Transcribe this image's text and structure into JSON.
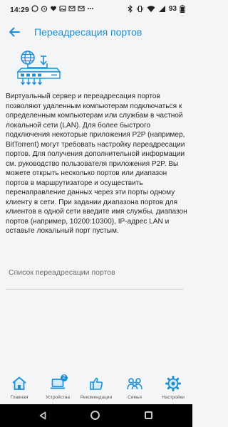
{
  "status_bar": {
    "time": "14:29",
    "battery": "93",
    "left_icons": [
      "whatsapp-icon",
      "alarm-icon",
      "heart-icon",
      "picture-icon",
      "email-icon",
      "email-icon",
      "more-dots-icon"
    ],
    "right_icons": [
      "bluetooth-icon",
      "vibrate-icon",
      "wifi-icon",
      "signal-icon",
      "battery-icon"
    ]
  },
  "header": {
    "title": "Переадресация портов"
  },
  "description": "Виртуальный сервер и переадресация портов позволяют удаленным компьютерам подключаться к определенным компьютерам или службам в частной локальной сети (LAN). Для более быстрого подключения некоторые приложения P2P (например, BitTorrent) могут требовать настройку переадресации портов. Для получения дополнительной информации см. руководство пользователя приложения P2P. Вы можете открыть несколько портов или диапазон портов в маршрутизаторе и осуществить перенаправление данных через эти порты одному клиенту в сети. При задании диапазона портов для клиентов в одной сети введите имя службы, диапазон портов (например, 10200:10300), IP-адрес LAN и оставьте локальный порт пустым.",
  "list": {
    "title": "Список переадресации портов"
  },
  "bottom_nav": {
    "items": [
      {
        "label": "Главная",
        "icon": "home-icon"
      },
      {
        "label": "Устройства",
        "icon": "laptop-icon",
        "badge": "2"
      },
      {
        "label": "Рекомендации",
        "icon": "thumb-up-icon"
      },
      {
        "label": "Семья",
        "icon": "family-icon"
      },
      {
        "label": "Настройки",
        "icon": "gear-icon"
      }
    ]
  },
  "colors": {
    "accent": "#1d8fd6",
    "background": "#f4f5f7",
    "system_nav": "#000000"
  }
}
